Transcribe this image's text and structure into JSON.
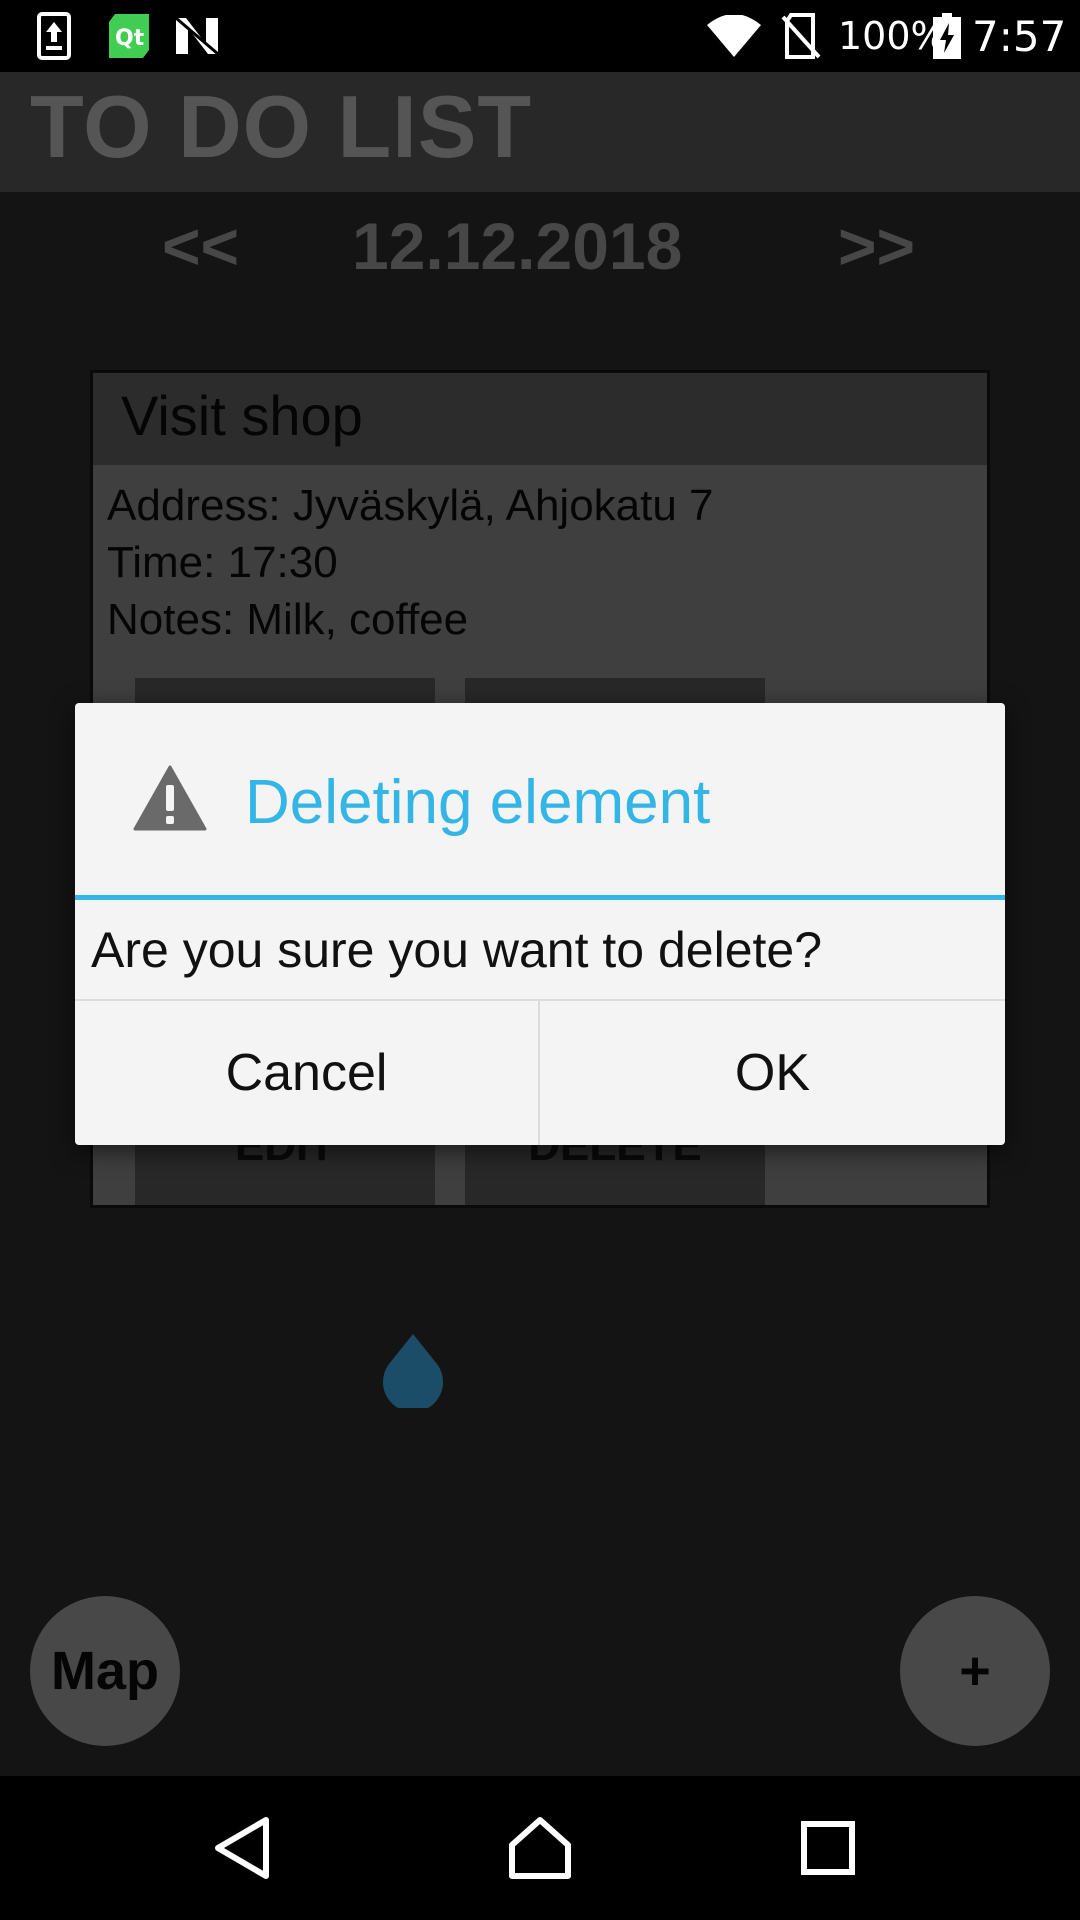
{
  "status_bar": {
    "battery": "100%",
    "time": "7:57",
    "icons": [
      "upload-notification-icon",
      "qt-app-icon",
      "n-app-icon",
      "wifi-icon",
      "no-sim-icon",
      "battery-charging-icon"
    ]
  },
  "app": {
    "title": "TO DO LIST",
    "nav_prev": "<<",
    "date": "12.12.2018",
    "nav_next": ">>"
  },
  "card": {
    "title": "Visit shop",
    "address": "Address: Jyväskylä, Ahjokatu 7",
    "time": "Time: 17:30",
    "notes": "Notes: Milk, coffee",
    "edit_label": "EDIT",
    "delete_label": "DELETE"
  },
  "fab": {
    "map_label": "Map",
    "add_label": "+"
  },
  "dialog": {
    "title": "Deleting element",
    "message": "Are you sure you want to delete?",
    "cancel_label": "Cancel",
    "ok_label": "OK",
    "accent_color": "#33b5e5"
  },
  "navbar": {
    "icons": [
      "back-icon",
      "home-icon",
      "recents-icon"
    ]
  }
}
